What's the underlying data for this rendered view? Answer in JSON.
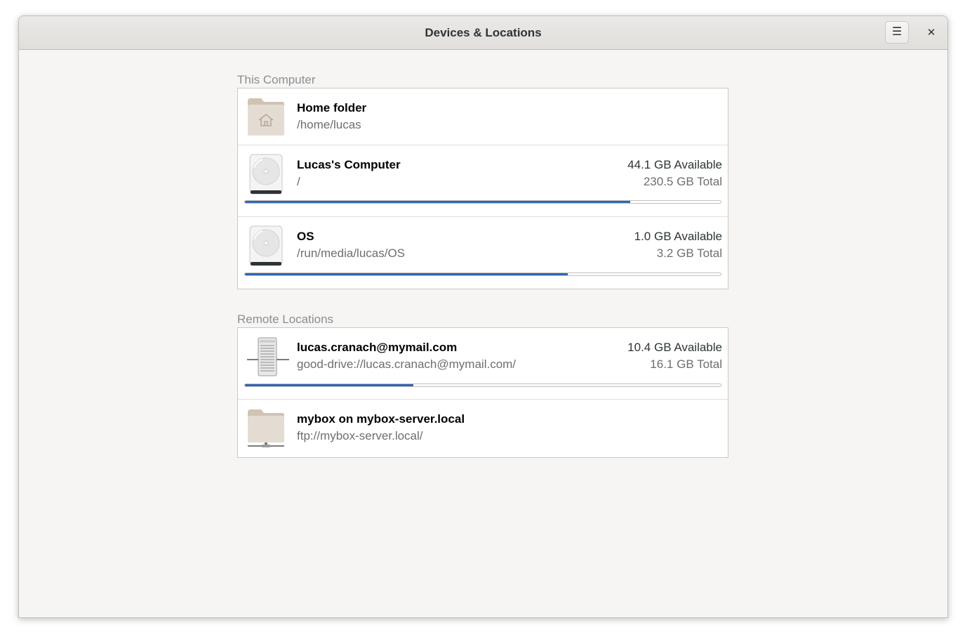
{
  "window": {
    "title": "Devices & Locations",
    "menu_icon": "hamburger-menu-icon",
    "close_icon": "close-icon",
    "menu_glyph": "☰",
    "close_glyph": "✕"
  },
  "colors": {
    "accent": "#3065b5",
    "background": "#f6f5f4"
  },
  "this_computer": {
    "label": "This Computer",
    "items": [
      {
        "name": "Home folder",
        "path": "/home/lucas",
        "icon": "home-folder-icon"
      },
      {
        "name": "Lucas's Computer",
        "path": "/",
        "available": "44.1 GB Available",
        "total": "230.5 GB Total",
        "used_fraction": 0.809,
        "icon": "hard-drive-icon"
      },
      {
        "name": "OS",
        "path": "/run/media/lucas/OS",
        "available": "1.0 GB Available",
        "total": "3.2 GB Total",
        "used_fraction": 0.679,
        "icon": "hard-drive-icon"
      }
    ]
  },
  "remote_locations": {
    "label": "Remote Locations",
    "items": [
      {
        "name": "lucas.cranach@mymail.com",
        "path": "good-drive://lucas.cranach@mymail.com/",
        "available": "10.4 GB Available",
        "total": "16.1 GB Total",
        "used_fraction": 0.354,
        "icon": "network-server-icon"
      },
      {
        "name": "mybox on mybox-server.local",
        "path": "ftp://mybox-server.local/",
        "icon": "network-folder-icon"
      }
    ]
  }
}
